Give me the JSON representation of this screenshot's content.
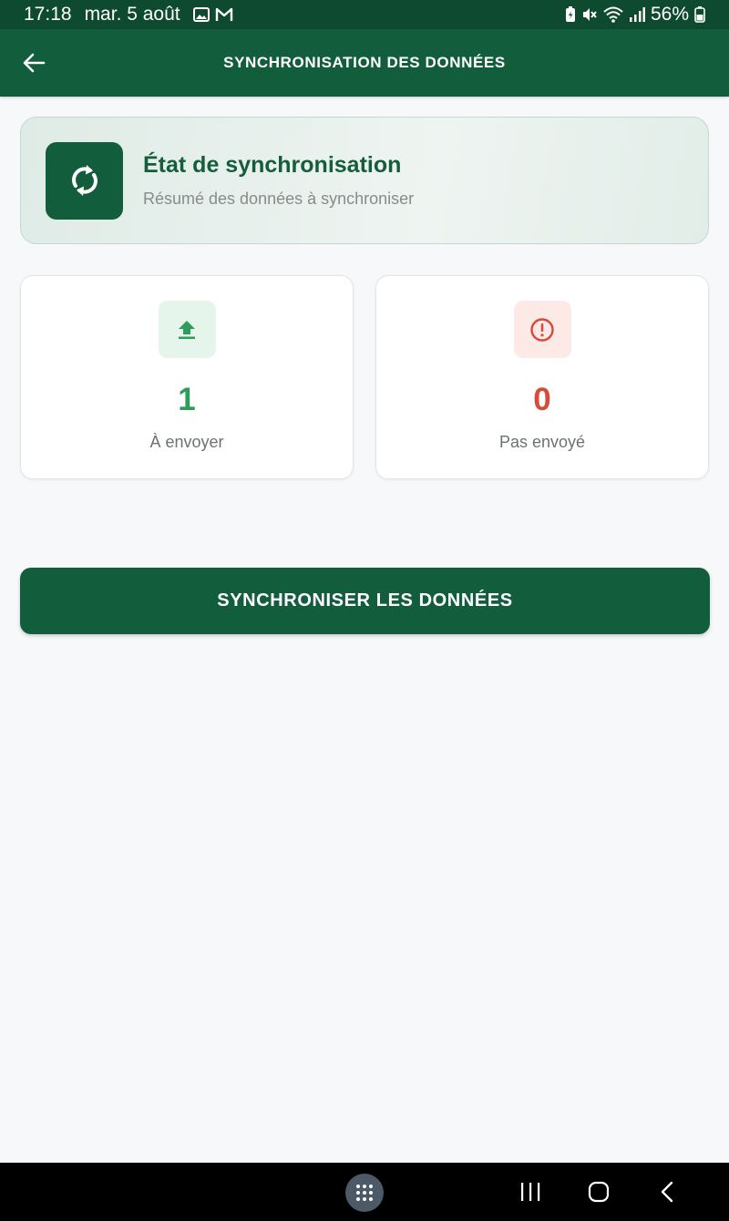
{
  "status_bar": {
    "time": "17:18",
    "date": "mar. 5 août",
    "battery": "56%",
    "icons_left": [
      "gallery-icon",
      "gmail-icon"
    ],
    "icons_right": [
      "battery-saver-icon",
      "mute-icon",
      "wifi-icon",
      "signal-icon",
      "battery-icon"
    ]
  },
  "app_bar": {
    "title": "SYNCHRONISATION DES DONNÉES",
    "back_icon": "arrow-left-icon"
  },
  "header_card": {
    "icon": "sync-icon",
    "title": "État de synchronisation",
    "subtitle": "Résumé des données à synchroniser"
  },
  "stats": [
    {
      "icon": "upload-icon",
      "value": "1",
      "label": "À envoyer",
      "color": "#2e9c5c",
      "icon_bg": "#e6f5ec"
    },
    {
      "icon": "alert-circle-icon",
      "value": "0",
      "label": "Pas envoyé",
      "color": "#d64a3a",
      "icon_bg": "#fdeae7"
    }
  ],
  "action": {
    "label": "SYNCHRONISER LES DONNÉES"
  },
  "colors": {
    "primary": "#125e3c",
    "status_bar": "#0d4a30",
    "background": "#f6f8fa",
    "success": "#2e9c5c",
    "danger": "#d64a3a"
  },
  "nav_bar": {
    "buttons": [
      "apps-icon",
      "recent-apps-icon",
      "home-icon",
      "back-icon"
    ]
  }
}
